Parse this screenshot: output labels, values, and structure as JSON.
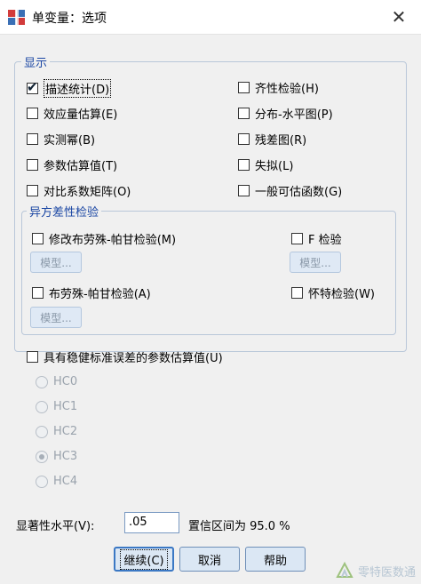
{
  "window": {
    "title": "单变量：选项",
    "close_glyph": "✕"
  },
  "display": {
    "legend": "显示",
    "left": [
      {
        "label": "描述统计(D)",
        "checked": true
      },
      {
        "label": "效应量估算(E)",
        "checked": false
      },
      {
        "label": "实测幂(B)",
        "checked": false
      },
      {
        "label": "参数估算值(T)",
        "checked": false
      },
      {
        "label": "对比系数矩阵(O)",
        "checked": false
      }
    ],
    "right": [
      {
        "label": "齐性检验(H)",
        "checked": false
      },
      {
        "label": "分布-水平图(P)",
        "checked": false
      },
      {
        "label": "残差图(R)",
        "checked": false
      },
      {
        "label": "失拟(L)",
        "checked": false
      },
      {
        "label": "一般可估函数(G)",
        "checked": false
      }
    ]
  },
  "hetero": {
    "legend": "异方差性检验",
    "modified_bp": {
      "label": "修改布劳殊-帕甘检验(M)",
      "checked": false
    },
    "f_test": {
      "label": "F 检验",
      "checked": false
    },
    "bp": {
      "label": "布劳殊-帕甘检验(A)",
      "checked": false
    },
    "white": {
      "label": "怀特检验(W)",
      "checked": false
    },
    "model_label": "模型..."
  },
  "robust": {
    "label": "具有稳健标准误差的参数估算值(U)",
    "checked": false,
    "options": [
      {
        "label": "HC0",
        "selected": false
      },
      {
        "label": "HC1",
        "selected": false
      },
      {
        "label": "HC2",
        "selected": false
      },
      {
        "label": "HC3",
        "selected": true
      },
      {
        "label": "HC4",
        "selected": false
      }
    ]
  },
  "significance": {
    "label": "显著性水平(V):",
    "value": ".05",
    "ci_text": "置信区间为 95.0 %"
  },
  "buttons": {
    "continue": "继续(C)",
    "cancel": "取消",
    "help": "帮助"
  },
  "watermark": {
    "text": "零特医数通"
  },
  "colors": {
    "legend_blue": "#1a46a3",
    "button_bg": "#dbe7f4",
    "default_border": "#3b78c4"
  }
}
